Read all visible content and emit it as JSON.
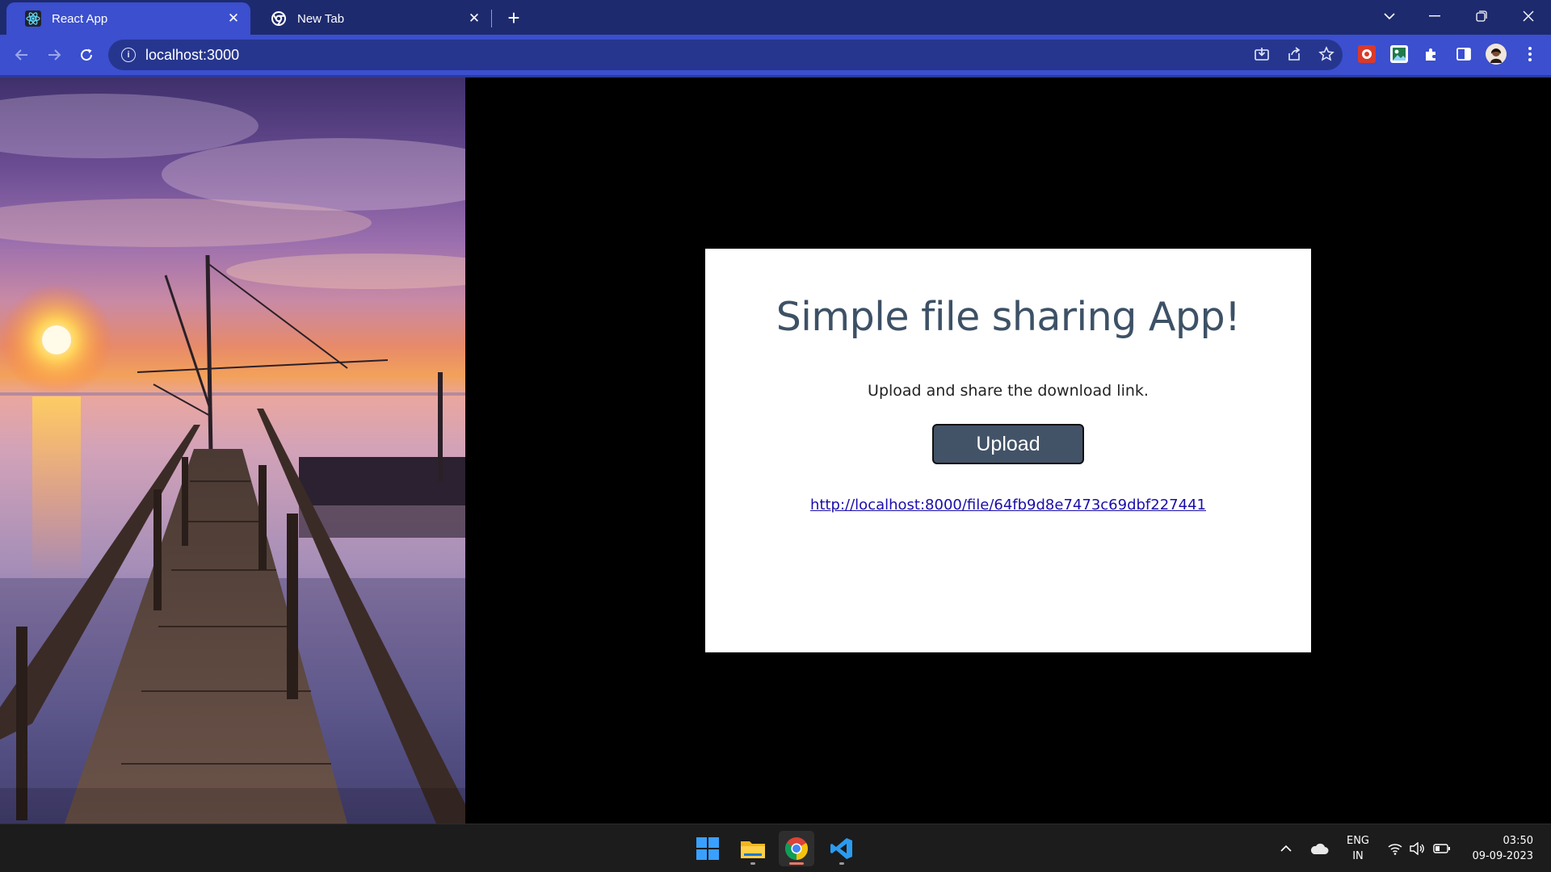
{
  "browser": {
    "tabs": [
      {
        "title": "React App",
        "active": true
      },
      {
        "title": "New Tab",
        "active": false
      }
    ],
    "url": "localhost:3000",
    "colors": {
      "frame": "#1e2a6e",
      "toolbar": "#3b4fcf",
      "omnibox": "#26368f"
    }
  },
  "app": {
    "heading": "Simple file sharing App!",
    "subtitle": "Upload and share the download link.",
    "upload_label": "Upload",
    "download_link": "http://localhost:8000/file/64fb9d8e7473c69dbf227441",
    "colors": {
      "heading": "#3d5166",
      "button": "#435367",
      "link": "#1a0dab"
    }
  },
  "taskbar": {
    "apps": [
      "windows-start",
      "file-explorer",
      "chrome",
      "vscode"
    ],
    "language": {
      "line1": "ENG",
      "line2": "IN"
    },
    "time": "03:50",
    "date": "09-09-2023"
  }
}
